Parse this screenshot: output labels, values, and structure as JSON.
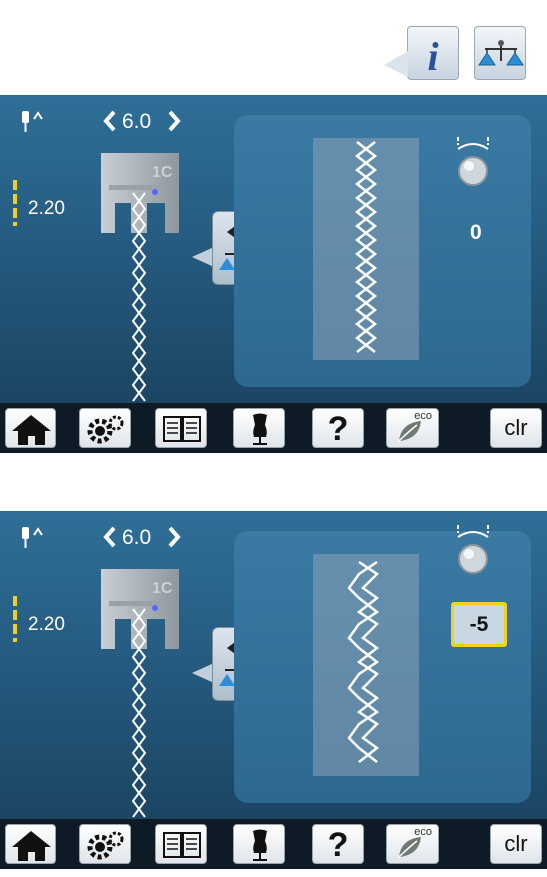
{
  "top_buttons": {
    "info": {
      "glyph": "i",
      "icon": "info-icon"
    },
    "balance": {
      "icon": "balance-icon"
    }
  },
  "screens": [
    {
      "stitch_width": "6.0",
      "stitch_length": "2.20",
      "presser_foot": "1C",
      "balance_value": "0",
      "balance_active": false,
      "preview": "cross-stitch-straight"
    },
    {
      "stitch_width": "6.0",
      "stitch_length": "2.20",
      "presser_foot": "1C",
      "balance_value": "-5",
      "balance_active": true,
      "preview": "cross-stitch-distorted"
    }
  ],
  "toolbar": {
    "home_icon": "home-icon",
    "settings_icon": "gear-icon",
    "tutorial_icon": "book-icon",
    "advisor_icon": "dress-form-icon",
    "help_label": "?",
    "eco_label": "eco",
    "clr_label": "clr"
  },
  "colors": {
    "screen_blue": "#2f6f97",
    "toolbar_dark": "#0e1a26",
    "highlight_yellow": "#f2d021",
    "icon_blue": "#2b4f9e"
  }
}
